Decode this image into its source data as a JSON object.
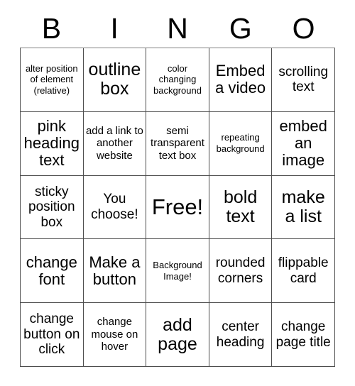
{
  "header": {
    "letters": [
      "B",
      "I",
      "N",
      "G",
      "O"
    ]
  },
  "grid": {
    "rows": [
      {
        "cells": [
          {
            "text": "alter position of element (relative)",
            "size": "xs"
          },
          {
            "text": "outline box",
            "size": "xl"
          },
          {
            "text": "color changing background",
            "size": "xs"
          },
          {
            "text": "Embed a video",
            "size": "lg"
          },
          {
            "text": "scrolling text",
            "size": "md"
          }
        ]
      },
      {
        "cells": [
          {
            "text": "pink heading text",
            "size": "lg"
          },
          {
            "text": "add a link to another website",
            "size": "sm"
          },
          {
            "text": "semi transparent text box",
            "size": "sm"
          },
          {
            "text": "repeating background",
            "size": "xs"
          },
          {
            "text": "embed an image",
            "size": "lg"
          }
        ]
      },
      {
        "cells": [
          {
            "text": "sticky position box",
            "size": "md"
          },
          {
            "text": "You choose!",
            "size": "md"
          },
          {
            "text": "Free!",
            "size": "xxl"
          },
          {
            "text": "bold text",
            "size": "xl"
          },
          {
            "text": "make a list",
            "size": "xl"
          }
        ]
      },
      {
        "cells": [
          {
            "text": "change font",
            "size": "lg"
          },
          {
            "text": "Make a button",
            "size": "lg"
          },
          {
            "text": "Background Image!",
            "size": "xs"
          },
          {
            "text": "rounded corners",
            "size": "md"
          },
          {
            "text": "flippable card",
            "size": "md"
          }
        ]
      },
      {
        "cells": [
          {
            "text": "change button on click",
            "size": "md"
          },
          {
            "text": "change mouse on hover",
            "size": "sm"
          },
          {
            "text": "add page",
            "size": "xl"
          },
          {
            "text": "center heading",
            "size": "md"
          },
          {
            "text": "change page title",
            "size": "md"
          }
        ]
      }
    ]
  },
  "colors": {
    "background": "#ffffff",
    "text": "#000000",
    "border": "#4d4d4d"
  }
}
